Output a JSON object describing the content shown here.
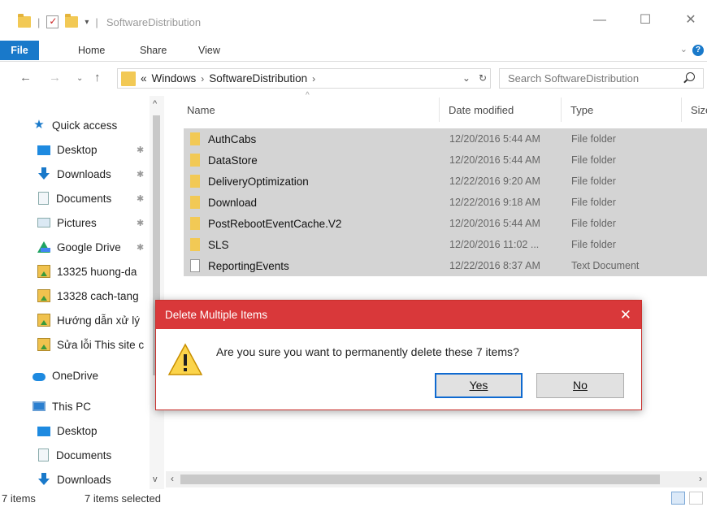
{
  "window": {
    "title": "SoftwareDistribution",
    "controls": {
      "minimize": "—",
      "maximize": "☐",
      "close": "✕"
    }
  },
  "ribbon": {
    "tabs": [
      "File",
      "Home",
      "Share",
      "View"
    ],
    "help": "?"
  },
  "address": {
    "prefix": "«",
    "crumbs": [
      "Windows",
      "SoftwareDistribution"
    ],
    "sep": "›"
  },
  "search": {
    "placeholder": "Search SoftwareDistribution"
  },
  "nav": {
    "quick_access": "Quick access",
    "items": [
      {
        "label": "Desktop",
        "icon": "desktop-icon",
        "pinned": true
      },
      {
        "label": "Downloads",
        "icon": "downloads-icon",
        "pinned": true
      },
      {
        "label": "Documents",
        "icon": "documents-icon",
        "pinned": true
      },
      {
        "label": "Pictures",
        "icon": "pictures-icon",
        "pinned": true
      },
      {
        "label": "Google Drive",
        "icon": "google-drive-icon",
        "pinned": true
      },
      {
        "label": "13325 huong-da",
        "icon": "image-folder-icon"
      },
      {
        "label": "13328 cach-tang",
        "icon": "image-folder-icon"
      },
      {
        "label": "Hướng dẫn xử lý",
        "icon": "image-folder-icon"
      },
      {
        "label": "Sửa lỗi This site c",
        "icon": "image-folder-icon"
      }
    ],
    "onedrive": "OneDrive",
    "this_pc": "This PC",
    "pc_items": [
      "Desktop",
      "Documents",
      "Downloads"
    ]
  },
  "columns": {
    "name": "Name",
    "date": "Date modified",
    "type": "Type",
    "size": "Size"
  },
  "files": [
    {
      "name": "AuthCabs",
      "date": "12/20/2016 5:44 AM",
      "type": "File folder",
      "kind": "folder"
    },
    {
      "name": "DataStore",
      "date": "12/20/2016 5:44 AM",
      "type": "File folder",
      "kind": "folder"
    },
    {
      "name": "DeliveryOptimization",
      "date": "12/22/2016 9:20 AM",
      "type": "File folder",
      "kind": "folder"
    },
    {
      "name": "Download",
      "date": "12/22/2016 9:18 AM",
      "type": "File folder",
      "kind": "folder"
    },
    {
      "name": "PostRebootEventCache.V2",
      "date": "12/20/2016 5:44 AM",
      "type": "File folder",
      "kind": "folder"
    },
    {
      "name": "SLS",
      "date": "12/20/2016 11:02 ...",
      "type": "File folder",
      "kind": "folder"
    },
    {
      "name": "ReportingEvents",
      "date": "12/22/2016 8:37 AM",
      "type": "Text Document",
      "kind": "text"
    }
  ],
  "status": {
    "count": "7 items",
    "selected": "7 items selected"
  },
  "dialog": {
    "title": "Delete Multiple Items",
    "message": "Are you sure you want to permanently delete these 7 items?",
    "yes": "Yes",
    "no": "No",
    "close": "✕"
  },
  "colors": {
    "accent": "#1979ca",
    "dialog_title": "#d9383a",
    "selection": "#d4d4d4"
  }
}
